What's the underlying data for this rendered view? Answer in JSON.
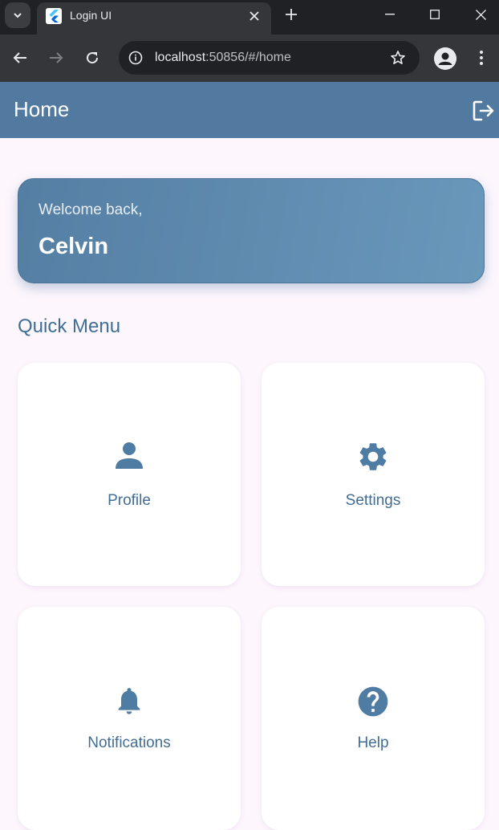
{
  "browser": {
    "tab_title": "Login UI",
    "url_host": "localhost",
    "url_rest": ":50856/#/home"
  },
  "app": {
    "title": "Home",
    "welcome_subtitle": "Welcome back,",
    "user_name": "Celvin",
    "section_title": "Quick Menu",
    "menu": [
      {
        "label": "Profile",
        "icon": "person-icon"
      },
      {
        "label": "Settings",
        "icon": "gear-icon"
      },
      {
        "label": "Notifications",
        "icon": "bell-icon"
      },
      {
        "label": "Help",
        "icon": "help-circle-icon"
      }
    ]
  },
  "colors": {
    "primary": "#527aa0",
    "accent_text": "#426d94",
    "background": "#fdf6fd"
  }
}
